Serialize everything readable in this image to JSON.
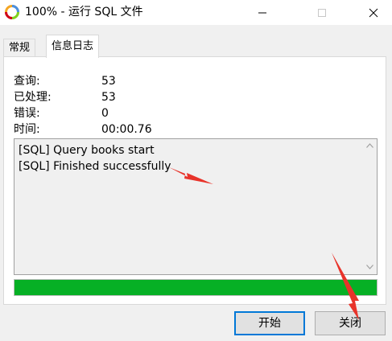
{
  "window": {
    "title": "100% - 运行 SQL 文件"
  },
  "tabs": [
    {
      "label": "常规",
      "active": false
    },
    {
      "label": "信息日志",
      "active": true
    }
  ],
  "stats": [
    {
      "label": "查询:",
      "value": "53"
    },
    {
      "label": "已处理:",
      "value": "53"
    },
    {
      "label": "错误:",
      "value": "0"
    },
    {
      "label": "时间:",
      "value": "00:00.76"
    }
  ],
  "log": {
    "lines": [
      "[SQL] Query books start",
      "[SQL] Finished successfully"
    ]
  },
  "progress": {
    "percent": 100,
    "color": "#06b025"
  },
  "buttons": {
    "start_label": "开始",
    "close_label": "关闭"
  },
  "annotations": {
    "arrow_color": "#e8332a"
  }
}
